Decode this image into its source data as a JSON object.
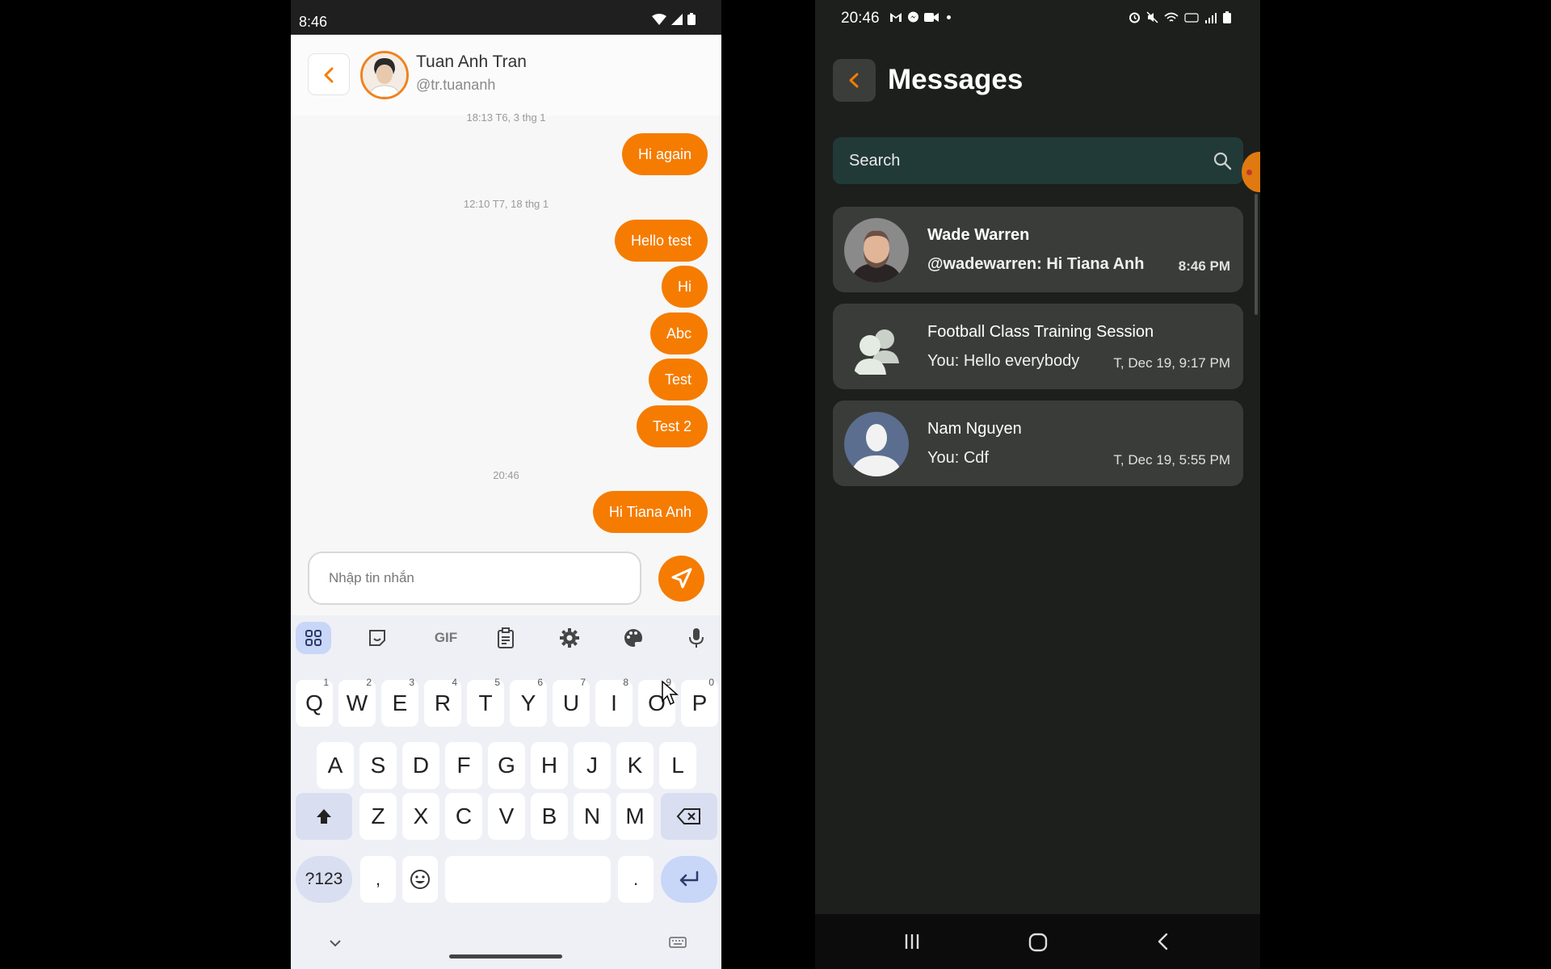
{
  "left_phone": {
    "status_time": "8:46",
    "chat_header": {
      "name": "Tuan Anh Tran",
      "handle": "@tr.tuananh"
    },
    "timestamps": [
      "18:13 T6, 3 thg 1",
      "12:10 T7, 18 thg 1",
      "20:46"
    ],
    "messages": [
      "Hi again",
      "Hello test",
      "Hi",
      "Abc",
      "Test",
      "Test 2",
      "Hi Tiana Anh"
    ],
    "input": {
      "placeholder": "Nhập tin nhắn"
    },
    "keyboard": {
      "tools": [
        "apps-icon",
        "sticker-icon",
        "GIF",
        "clipboard-icon",
        "settings-icon",
        "palette-icon",
        "mic-icon"
      ],
      "gif_label": "GIF",
      "row1": [
        {
          "k": "Q",
          "n": "1"
        },
        {
          "k": "W",
          "n": "2"
        },
        {
          "k": "E",
          "n": "3"
        },
        {
          "k": "R",
          "n": "4"
        },
        {
          "k": "T",
          "n": "5"
        },
        {
          "k": "Y",
          "n": "6"
        },
        {
          "k": "U",
          "n": "7"
        },
        {
          "k": "I",
          "n": "8"
        },
        {
          "k": "O",
          "n": "9"
        },
        {
          "k": "P",
          "n": "0"
        }
      ],
      "row2": [
        "A",
        "S",
        "D",
        "F",
        "G",
        "H",
        "J",
        "K",
        "L"
      ],
      "row3": [
        "Z",
        "X",
        "C",
        "V",
        "B",
        "N",
        "M"
      ],
      "symbols_label": "?123",
      "comma": ",",
      "period": "."
    }
  },
  "right_phone": {
    "status_time": "20:46",
    "title": "Messages",
    "search": {
      "placeholder": "Search"
    },
    "conversations": [
      {
        "name": "Wade Warren",
        "preview": "@wadewarren: Hi Tiana Anh",
        "time": "8:46 PM",
        "bold": true
      },
      {
        "name": "Football Class Training Session",
        "preview": "You: Hello everybody",
        "time": "T, Dec 19, 9:17 PM",
        "bold": false
      },
      {
        "name": "Nam Nguyen",
        "preview": "You: Cdf",
        "time": "T, Dec 19, 5:55 PM",
        "bold": false
      }
    ]
  },
  "colors": {
    "accent": "#f57c00",
    "dark_bg": "#1d1f1c",
    "card_bg": "#3a3c39",
    "search_bg": "#213a38"
  }
}
